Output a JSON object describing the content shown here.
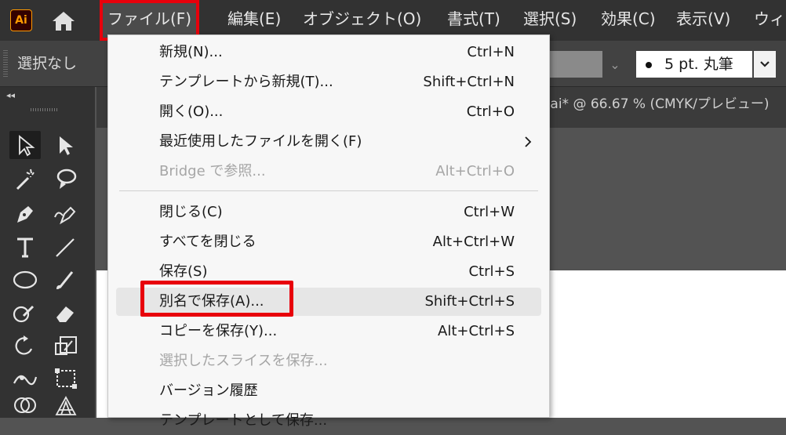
{
  "app": {
    "logo": "Ai"
  },
  "menubar": {
    "items": [
      "ファイル(F)",
      "編集(E)",
      "オブジェクト(O)",
      "書式(T)",
      "選択(S)",
      "効果(C)",
      "表示(V)",
      "ウィ"
    ]
  },
  "controlbar": {
    "selection_label": "選択なし",
    "brush_value": "5 pt. 丸筆"
  },
  "document": {
    "tab_title": ".ai* @ 66.67 % (CMYK/プレビュー)"
  },
  "file_menu": {
    "items": [
      {
        "label": "新規(N)...",
        "shortcut": "Ctrl+N"
      },
      {
        "label": "テンプレートから新規(T)...",
        "shortcut": "Shift+Ctrl+N"
      },
      {
        "label": "開く(O)...",
        "shortcut": "Ctrl+O"
      },
      {
        "label": "最近使用したファイルを開く(F)",
        "shortcut": ""
      },
      {
        "label": "Bridge で参照...",
        "shortcut": "Alt+Ctrl+O"
      },
      {
        "label": "閉じる(C)",
        "shortcut": "Ctrl+W"
      },
      {
        "label": "すべてを閉じる",
        "shortcut": "Alt+Ctrl+W"
      },
      {
        "label": "保存(S)",
        "shortcut": "Ctrl+S"
      },
      {
        "label": "別名で保存(A)...",
        "shortcut": "Shift+Ctrl+S"
      },
      {
        "label": "コピーを保存(Y)...",
        "shortcut": "Alt+Ctrl+S"
      },
      {
        "label": "選択したスライスを保存...",
        "shortcut": ""
      },
      {
        "label": "バージョン履歴",
        "shortcut": ""
      },
      {
        "label": "テンプレートとして保存...",
        "shortcut": ""
      }
    ]
  },
  "colors": {
    "highlight": "#e8000b",
    "logo_accent": "#ff9a00",
    "menubar_bg": "#323232",
    "menu_bg": "#f7f7f7"
  },
  "icons": {
    "home": "home-icon",
    "submenu": "chevron-right-icon",
    "dropdown": "chevron-down-icon"
  }
}
